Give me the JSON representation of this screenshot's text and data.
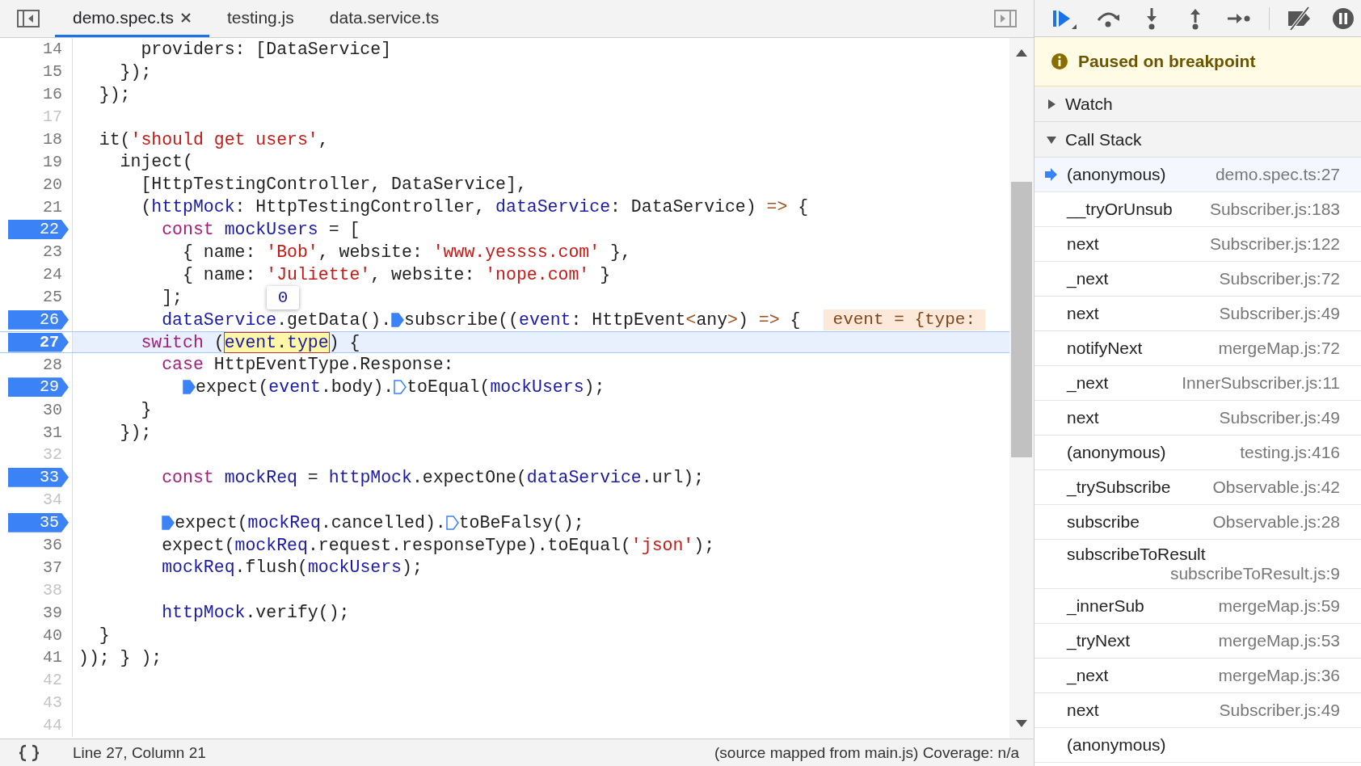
{
  "editor_tabs": [
    {
      "label": "demo.spec.ts",
      "selected": true,
      "closable": true
    },
    {
      "label": "testing.js",
      "selected": false,
      "closable": false
    },
    {
      "label": "data.service.ts",
      "selected": false,
      "closable": false
    }
  ],
  "code_lines": [
    {
      "number": "14",
      "breakpoint": false,
      "current": false,
      "tokens": [
        {
          "kind": "plain",
          "text": "      providers: [DataService]"
        }
      ]
    },
    {
      "number": "15",
      "breakpoint": false,
      "current": false,
      "tokens": [
        {
          "kind": "plain",
          "text": "    });"
        }
      ]
    },
    {
      "number": "16",
      "breakpoint": false,
      "current": false,
      "tokens": [
        {
          "kind": "plain",
          "text": "  });"
        }
      ]
    },
    {
      "number": "17",
      "breakpoint": false,
      "current": false
    },
    {
      "number": "18",
      "breakpoint": false,
      "current": false,
      "tokens": [
        {
          "kind": "plain",
          "text": "  it("
        },
        {
          "kind": "string",
          "text": "'should get users'"
        },
        {
          "kind": "plain",
          "text": ","
        }
      ]
    },
    {
      "number": "19",
      "breakpoint": false,
      "current": false,
      "tokens": [
        {
          "kind": "plain",
          "text": "    inject("
        }
      ]
    },
    {
      "number": "20",
      "breakpoint": false,
      "current": false,
      "tokens": [
        {
          "kind": "plain",
          "text": "      [HttpTestingController, DataService],"
        }
      ]
    },
    {
      "number": "21",
      "breakpoint": false,
      "current": false,
      "tokens": [
        {
          "kind": "plain",
          "text": "      ("
        },
        {
          "kind": "variable",
          "text": "httpMock"
        },
        {
          "kind": "plain",
          "text": ": HttpTestingController, "
        },
        {
          "kind": "variable",
          "text": "dataService"
        },
        {
          "kind": "plain",
          "text": ": DataService) "
        },
        {
          "kind": "operator",
          "text": "=>"
        },
        {
          "kind": "plain",
          "text": " {"
        }
      ]
    },
    {
      "number": "22",
      "breakpoint": true,
      "current": false,
      "tokens": [
        {
          "kind": "keyword",
          "text": "        const"
        },
        {
          "kind": "variable",
          "text": " mockUsers"
        },
        {
          "kind": "plain",
          "text": " = ["
        }
      ]
    },
    {
      "number": "23",
      "breakpoint": false,
      "current": false,
      "tokens": [
        {
          "kind": "plain",
          "text": "          { name: "
        },
        {
          "kind": "string",
          "text": "'Bob'"
        },
        {
          "kind": "plain",
          "text": ", website: "
        },
        {
          "kind": "string",
          "text": "'www.yessss.com'"
        },
        {
          "kind": "plain",
          "text": " },"
        }
      ]
    },
    {
      "number": "24",
      "breakpoint": false,
      "current": false,
      "tokens": [
        {
          "kind": "plain",
          "text": "          { name: "
        },
        {
          "kind": "string",
          "text": "'Juliette'"
        },
        {
          "kind": "plain",
          "text": ", website: "
        },
        {
          "kind": "string",
          "text": "'nope.com'"
        },
        {
          "kind": "plain",
          "text": " }"
        }
      ]
    },
    {
      "number": "25",
      "breakpoint": false,
      "current": false,
      "tokens": [
        {
          "kind": "plain",
          "text": "        ];"
        }
      ]
    },
    {
      "number": "26",
      "breakpoint": true,
      "current": false,
      "inline_value": "event = {type:",
      "tokens": [
        {
          "kind": "variable",
          "text": "        dataService"
        },
        {
          "kind": "plain",
          "text": ".getData()."
        },
        {
          "kind": "plain",
          "text": "subscribe((",
          "marker_active": true
        },
        {
          "kind": "variable",
          "text": "event"
        },
        {
          "kind": "plain",
          "text": ": HttpEvent"
        },
        {
          "kind": "operator",
          "text": "<"
        },
        {
          "kind": "plain",
          "text": "any"
        },
        {
          "kind": "operator",
          "text": ">"
        },
        {
          "kind": "plain",
          "text": ") "
        },
        {
          "kind": "operator",
          "text": "=>"
        },
        {
          "kind": "plain",
          "text": " {"
        }
      ]
    },
    {
      "number": "27",
      "breakpoint": true,
      "current": true,
      "tokens": [
        {
          "kind": "keyword",
          "text": "      switch"
        },
        {
          "kind": "plain",
          "text": " ("
        },
        {
          "kind": "highlight",
          "parts": [
            {
              "kind": "variable",
              "text": "event"
            },
            {
              "kind": "plain",
              "text": "."
            },
            {
              "kind": "variable",
              "text": "type"
            }
          ]
        },
        {
          "kind": "plain",
          "text": ") {"
        }
      ]
    },
    {
      "number": "28",
      "breakpoint": false,
      "current": false,
      "tokens": [
        {
          "kind": "keyword",
          "text": "        case"
        },
        {
          "kind": "plain",
          "text": " HttpEventType.Response:"
        }
      ]
    },
    {
      "number": "29",
      "breakpoint": true,
      "current": false,
      "tokens": [
        {
          "kind": "plain",
          "text": "          expect(",
          "marker_active": true
        },
        {
          "kind": "variable",
          "text": "event"
        },
        {
          "kind": "plain",
          "text": ".body)."
        },
        {
          "kind": "plain",
          "text": "toEqual(",
          "marker_active": false
        },
        {
          "kind": "variable",
          "text": "mockUsers"
        },
        {
          "kind": "plain",
          "text": ");"
        }
      ]
    },
    {
      "number": "30",
      "breakpoint": false,
      "current": false,
      "tokens": [
        {
          "kind": "plain",
          "text": "      }"
        }
      ]
    },
    {
      "number": "31",
      "breakpoint": false,
      "current": false,
      "tokens": [
        {
          "kind": "plain",
          "text": "    });"
        }
      ]
    },
    {
      "number": "32",
      "breakpoint": false,
      "current": false
    },
    {
      "number": "33",
      "breakpoint": true,
      "current": false,
      "tokens": [
        {
          "kind": "keyword",
          "text": "        const"
        },
        {
          "kind": "variable",
          "text": " mockReq"
        },
        {
          "kind": "plain",
          "text": " = "
        },
        {
          "kind": "variable",
          "text": "httpMock"
        },
        {
          "kind": "plain",
          "text": ".expectOne("
        },
        {
          "kind": "variable",
          "text": "dataService"
        },
        {
          "kind": "plain",
          "text": ".url);"
        }
      ]
    },
    {
      "number": "34",
      "breakpoint": false,
      "current": false
    },
    {
      "number": "35",
      "breakpoint": true,
      "current": false,
      "tokens": [
        {
          "kind": "plain",
          "text": "        expect(",
          "marker_active": true
        },
        {
          "kind": "variable",
          "text": "mockReq"
        },
        {
          "kind": "plain",
          "text": ".cancelled)."
        },
        {
          "kind": "plain",
          "text": "toBeFalsy();",
          "marker_active": false
        }
      ]
    },
    {
      "number": "36",
      "breakpoint": false,
      "current": false,
      "tokens": [
        {
          "kind": "plain",
          "text": "        expect("
        },
        {
          "kind": "variable",
          "text": "mockReq"
        },
        {
          "kind": "plain",
          "text": ".request.responseType).toEqual("
        },
        {
          "kind": "string",
          "text": "'json'"
        },
        {
          "kind": "plain",
          "text": ");"
        }
      ]
    },
    {
      "number": "37",
      "breakpoint": false,
      "current": false,
      "tokens": [
        {
          "kind": "variable",
          "text": "        mockReq"
        },
        {
          "kind": "plain",
          "text": ".flush("
        },
        {
          "kind": "variable",
          "text": "mockUsers"
        },
        {
          "kind": "plain",
          "text": ");"
        }
      ]
    },
    {
      "number": "38",
      "breakpoint": false,
      "current": false
    },
    {
      "number": "39",
      "breakpoint": false,
      "current": false,
      "tokens": [
        {
          "kind": "variable",
          "text": "        httpMock"
        },
        {
          "kind": "plain",
          "text": ".verify();"
        }
      ]
    },
    {
      "number": "40",
      "breakpoint": false,
      "current": false,
      "tokens": [
        {
          "kind": "plain",
          "text": "  }"
        }
      ]
    },
    {
      "number": "41",
      "breakpoint": false,
      "current": false,
      "tokens": [
        {
          "kind": "plain",
          "text": ")); } );"
        }
      ]
    },
    {
      "number": "42",
      "breakpoint": false,
      "current": false
    },
    {
      "number": "43",
      "breakpoint": false,
      "current": false
    },
    {
      "number": "44",
      "breakpoint": false,
      "current": false
    }
  ],
  "value_tooltip": "0",
  "status_bar": {
    "position": "Line 27, Column 21",
    "source": "(source mapped from main.js) Coverage: n/a"
  },
  "debugger": {
    "banner": "Paused on breakpoint",
    "sections": [
      {
        "title": "Watch",
        "expanded": false
      },
      {
        "title": "Call Stack",
        "expanded": true
      }
    ],
    "call_stack": [
      {
        "function": "(anonymous)",
        "location": "demo.spec.ts:27",
        "selected": true
      },
      {
        "function": "__tryOrUnsub",
        "location": "Subscriber.js:183",
        "selected": false
      },
      {
        "function": "next",
        "location": "Subscriber.js:122",
        "selected": false
      },
      {
        "function": "_next",
        "location": "Subscriber.js:72",
        "selected": false
      },
      {
        "function": "next",
        "location": "Subscriber.js:49",
        "selected": false
      },
      {
        "function": "notifyNext",
        "location": "mergeMap.js:72",
        "selected": false
      },
      {
        "function": "_next",
        "location": "InnerSubscriber.js:11",
        "selected": false
      },
      {
        "function": "next",
        "location": "Subscriber.js:49",
        "selected": false
      },
      {
        "function": "(anonymous)",
        "location": "testing.js:416",
        "selected": false
      },
      {
        "function": "_trySubscribe",
        "location": "Observable.js:42",
        "selected": false
      },
      {
        "function": "subscribe",
        "location": "Observable.js:28",
        "selected": false
      },
      {
        "function": "subscribeToResult",
        "location": "subscribeToResult.js:9",
        "selected": false
      },
      {
        "function": "_innerSub",
        "location": "mergeMap.js:59",
        "selected": false
      },
      {
        "function": "_tryNext",
        "location": "mergeMap.js:53",
        "selected": false
      },
      {
        "function": "_next",
        "location": "mergeMap.js:36",
        "selected": false
      },
      {
        "function": "next",
        "location": "Subscriber.js:49",
        "selected": false
      },
      {
        "function": "(anonymous)",
        "selected": false
      }
    ]
  }
}
